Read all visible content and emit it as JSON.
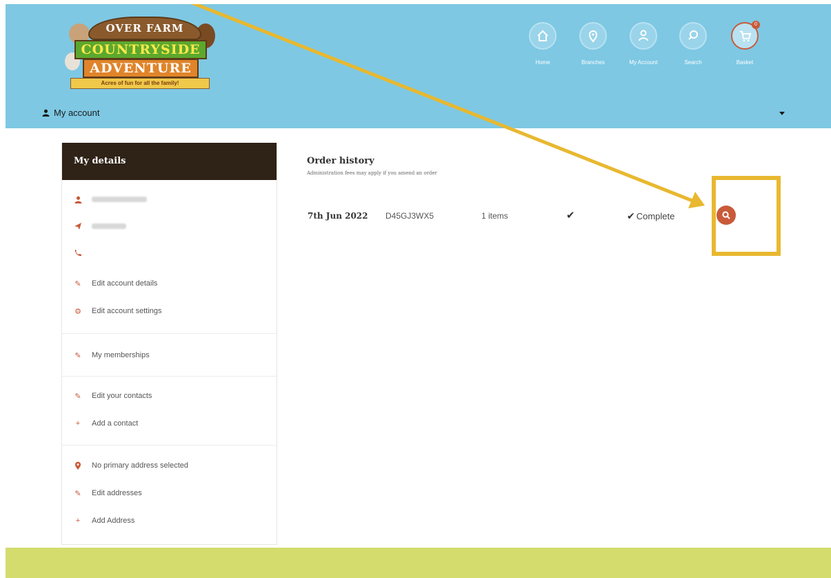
{
  "brand": {
    "logo_top": "OVER FARM",
    "logo_line1": "COUNTRYSIDE",
    "logo_line2": "ADVENTURE",
    "logo_tagline": "Acres of fun for all the family!"
  },
  "nav": {
    "items": [
      {
        "label": "Home",
        "icon": "home-icon"
      },
      {
        "label": "Branches",
        "icon": "location-pin-icon"
      },
      {
        "label": "My Account",
        "icon": "user-icon"
      },
      {
        "label": "Search",
        "icon": "search-icon"
      },
      {
        "label": "Basket",
        "icon": "cart-icon"
      }
    ],
    "basket_count": "0"
  },
  "account_bar": {
    "label": "My account"
  },
  "sidebar": {
    "title": "My details",
    "items": [
      {
        "label": "Edit account details",
        "icon": "pencil-icon"
      },
      {
        "label": "Edit account settings",
        "icon": "gear-icon"
      },
      {
        "label": "My memberships",
        "icon": "pencil-icon"
      },
      {
        "label": "Edit your contacts",
        "icon": "pencil-icon"
      },
      {
        "label": "Add a contact",
        "icon": "plus-icon"
      },
      {
        "label": "No primary address selected",
        "icon": "location-pin-icon"
      },
      {
        "label": "Edit addresses",
        "icon": "pencil-icon"
      },
      {
        "label": "Add Address",
        "icon": "plus-icon"
      }
    ]
  },
  "orders": {
    "title": "Order history",
    "subtitle": "Administration fees may apply if you amend an order",
    "rows": [
      {
        "date": "7th Jun 2022",
        "reference": "D45GJ3WX5",
        "items": "1 items",
        "status": "Complete"
      }
    ]
  },
  "colors": {
    "header": "#7ec8e3",
    "sidebar_header": "#2f2216",
    "accent": "#c95a3a",
    "annotation": "#e8b830",
    "footer": "#d4dc6e"
  }
}
